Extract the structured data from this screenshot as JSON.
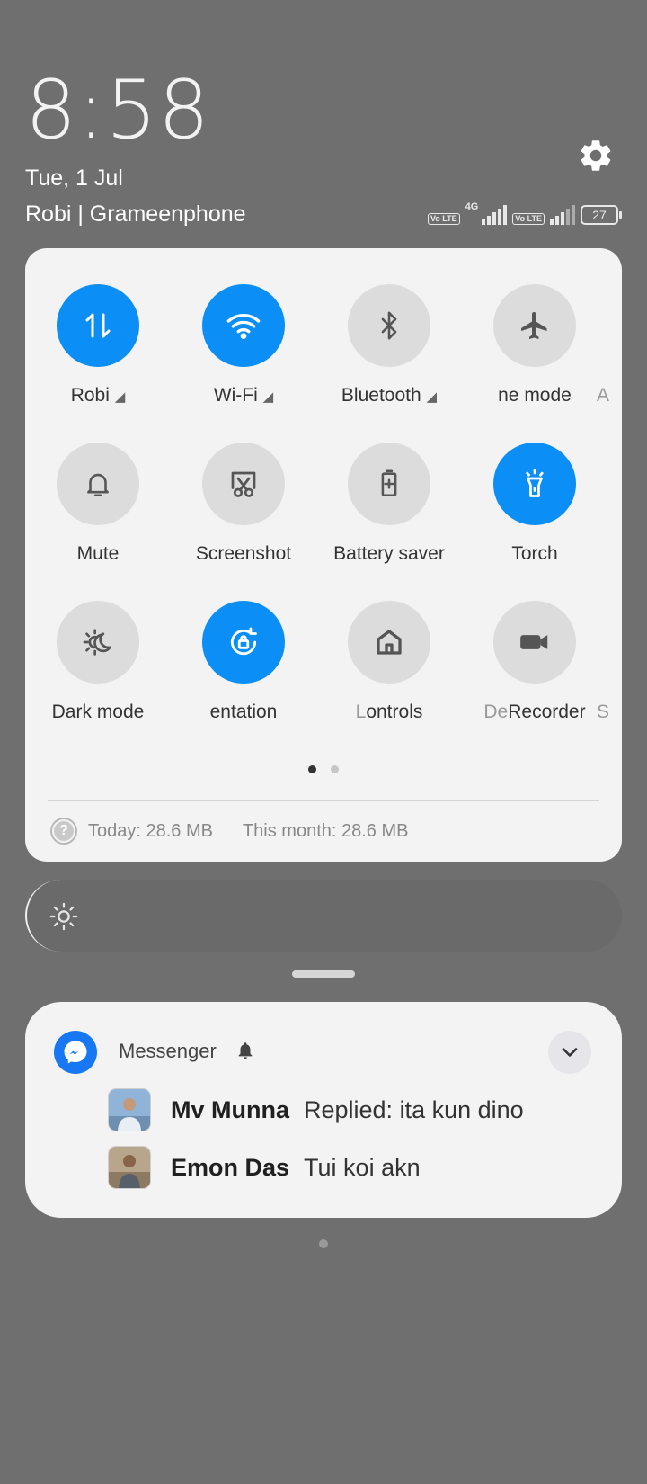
{
  "clock": {
    "time": "8:58",
    "date": "Tue, 1 Jul",
    "carrier": "Robi | Grameenphone"
  },
  "status_bar": {
    "sim1_tag": "Vo LTE",
    "network_type": "4G",
    "sim2_tag": "Vo LTE",
    "battery": "27"
  },
  "quick_settings": {
    "tiles": [
      {
        "label": "Robi",
        "triangle": true,
        "active": true,
        "icon": "mobile-data-icon"
      },
      {
        "label": "Wi-Fi",
        "triangle": true,
        "active": true,
        "icon": "wifi-icon"
      },
      {
        "label": "Bluetooth",
        "triangle": true,
        "active": false,
        "icon": "bluetooth-icon"
      },
      {
        "label": "ne mode",
        "triangle": false,
        "active": false,
        "icon": "airplane-icon"
      },
      {
        "label": "Mute",
        "active": false,
        "icon": "bell-icon"
      },
      {
        "label": "Screenshot",
        "active": false,
        "icon": "screenshot-icon"
      },
      {
        "label": "Battery saver",
        "active": false,
        "icon": "battery-saver-icon"
      },
      {
        "label": "Torch",
        "active": true,
        "icon": "torch-icon"
      },
      {
        "label": "Dark mode",
        "active": false,
        "icon": "dark-mode-icon"
      },
      {
        "label": "entation",
        "active": true,
        "icon": "rotation-lock-icon"
      },
      {
        "label": "ontrols",
        "ghost": "L",
        "active": false,
        "icon": "home-controls-icon"
      },
      {
        "label": "Recorder",
        "ghost": "De",
        "active": false,
        "icon": "video-recorder-icon"
      }
    ],
    "edge_peek": {
      "row1": "A",
      "row3": "S"
    },
    "data_usage": {
      "today": "Today: 28.6 MB",
      "month": "This month: 28.6 MB",
      "help_glyph": "?"
    }
  },
  "notification": {
    "app": "Messenger",
    "messages": [
      {
        "sender": "Mv Munna",
        "text": "Replied: ita kun dino"
      },
      {
        "sender": "Emon Das",
        "text": "Tui koi akn"
      }
    ]
  },
  "colors": {
    "active": "#0b8ef5",
    "inactive": "#dcdcdc",
    "panel": "#f3f3f3",
    "background": "#6f6f6f",
    "messenger": "#1877f2"
  }
}
